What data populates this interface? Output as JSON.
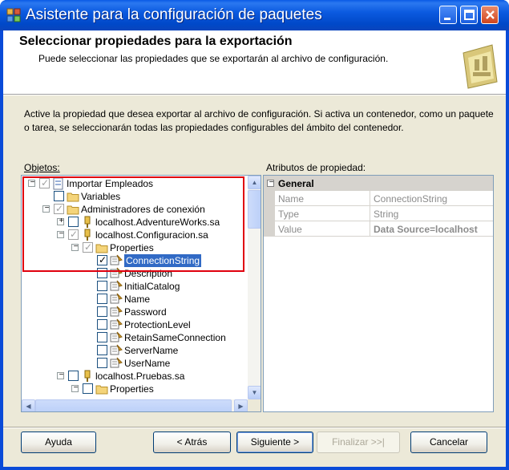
{
  "window": {
    "title": "Asistente para la configuración de paquetes"
  },
  "header": {
    "title": "Seleccionar propiedades para la exportación",
    "subtitle": "Puede seleccionar las propiedades que se exportarán al archivo de configuración."
  },
  "intro_text": "Active la propiedad que desea exportar al archivo de configuración. Si activa un contenedor, como un paquete o tarea, se seleccionarán todas las propiedades configurables del ámbito del contenedor.",
  "objects": {
    "label": "Objetos:",
    "tree": [
      {
        "label": "Importar Empleados",
        "expander": "−",
        "check": "grayed",
        "icon": "package-icon"
      },
      {
        "label": "Variables",
        "expander": "",
        "check": "unchecked",
        "icon": "folder-icon"
      },
      {
        "label": "Administradores de conexión",
        "expander": "−",
        "check": "grayed",
        "icon": "folder-icon"
      },
      {
        "label": "localhost.AdventureWorks.sa",
        "expander": "+",
        "check": "unchecked",
        "icon": "connection-icon"
      },
      {
        "label": "localhost.Configuracion.sa",
        "expander": "−",
        "check": "grayed",
        "icon": "connection-icon"
      },
      {
        "label": "Properties",
        "expander": "−",
        "check": "grayed",
        "icon": "folder-icon"
      },
      {
        "label": "ConnectionString",
        "expander": "",
        "check": "checked",
        "icon": "property-icon",
        "selected": true
      },
      {
        "label": "Description",
        "expander": "",
        "check": "unchecked",
        "icon": "property-icon"
      },
      {
        "label": "InitialCatalog",
        "expander": "",
        "check": "unchecked",
        "icon": "property-icon"
      },
      {
        "label": "Name",
        "expander": "",
        "check": "unchecked",
        "icon": "property-icon"
      },
      {
        "label": "Password",
        "expander": "",
        "check": "unchecked",
        "icon": "property-icon"
      },
      {
        "label": "ProtectionLevel",
        "expander": "",
        "check": "unchecked",
        "icon": "property-icon"
      },
      {
        "label": "RetainSameConnection",
        "expander": "",
        "check": "unchecked",
        "icon": "property-icon"
      },
      {
        "label": "ServerName",
        "expander": "",
        "check": "unchecked",
        "icon": "property-icon"
      },
      {
        "label": "UserName",
        "expander": "",
        "check": "unchecked",
        "icon": "property-icon"
      },
      {
        "label": "localhost.Pruebas.sa",
        "expander": "−",
        "check": "unchecked",
        "icon": "connection-icon"
      },
      {
        "label": "Properties",
        "expander": "−",
        "check": "unchecked",
        "icon": "folder-icon"
      }
    ]
  },
  "attributes": {
    "label": "Atributos de propiedad:",
    "category": "General",
    "rows": [
      {
        "name": "Name",
        "value": "ConnectionString"
      },
      {
        "name": "Type",
        "value": "String"
      },
      {
        "name": "Value",
        "value": "Data Source=localhost"
      }
    ]
  },
  "buttons": {
    "help": "Ayuda",
    "back": "< Atrás",
    "next": "Siguiente >",
    "finish": "Finalizar >>|",
    "cancel": "Cancelar"
  },
  "colors": {
    "titlebar": "#0a5ae6",
    "selection": "#316ac5",
    "highlight_border": "#e0000e"
  }
}
